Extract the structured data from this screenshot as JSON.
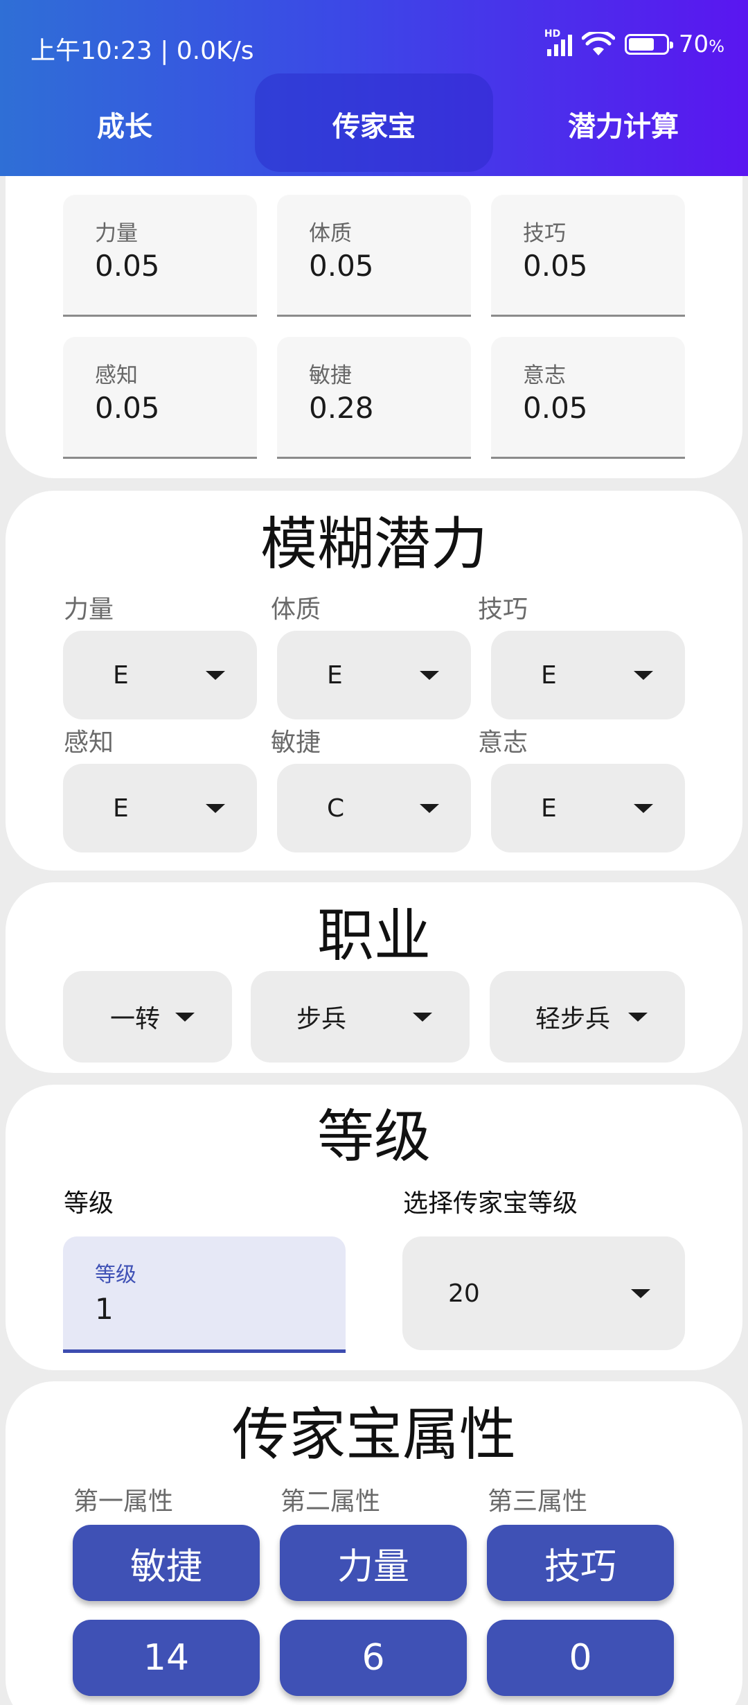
{
  "status_bar": {
    "time": "上午10:23 | 0.0K/s",
    "battery": "70",
    "battery_unit": "%",
    "battery_level": 0.7,
    "network": "HD"
  },
  "tabs": [
    {
      "label": "成长",
      "active": false
    },
    {
      "label": "传家宝",
      "active": true
    },
    {
      "label": "潜力计算",
      "active": false
    }
  ],
  "potential_values": {
    "fields": [
      {
        "label": "力量",
        "value": "0.05"
      },
      {
        "label": "体质",
        "value": "0.05"
      },
      {
        "label": "技巧",
        "value": "0.05"
      },
      {
        "label": "感知",
        "value": "0.05"
      },
      {
        "label": "敏捷",
        "value": "0.28"
      },
      {
        "label": "意志",
        "value": "0.05"
      }
    ]
  },
  "fuzzy_potential": {
    "title": "模糊潜力",
    "fields": [
      {
        "label": "力量",
        "value": "E"
      },
      {
        "label": "体质",
        "value": "E"
      },
      {
        "label": "技巧",
        "value": "E"
      },
      {
        "label": "感知",
        "value": "E"
      },
      {
        "label": "敏捷",
        "value": "C"
      },
      {
        "label": "意志",
        "value": "E"
      }
    ]
  },
  "profession": {
    "title": "职业",
    "selects": [
      {
        "value": "一转"
      },
      {
        "value": "步兵"
      },
      {
        "value": "轻步兵"
      }
    ]
  },
  "level": {
    "title": "等级",
    "level_label": "等级",
    "input_label": "等级",
    "input_value": "1",
    "heirloom_label": "选择传家宝等级",
    "heirloom_value": "20"
  },
  "heirloom_attributes": {
    "title": "传家宝属性",
    "columns": [
      {
        "label": "第一属性",
        "attribute": "敏捷",
        "value": "14"
      },
      {
        "label": "第二属性",
        "attribute": "力量",
        "value": "6"
      },
      {
        "label": "第三属性",
        "attribute": "技巧",
        "value": "0"
      }
    ]
  },
  "colors": {
    "header_start": "#2f6fd6",
    "header_end": "#5a16f0",
    "accent": "#3f51b5"
  }
}
